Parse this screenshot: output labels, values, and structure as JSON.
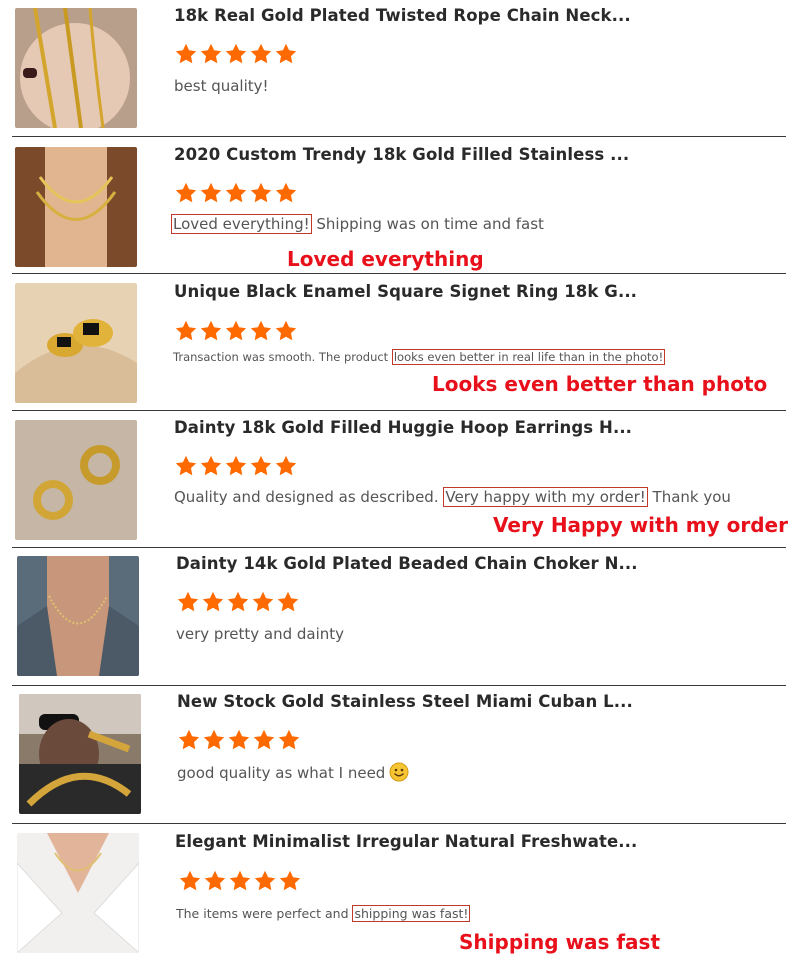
{
  "colors": {
    "star": "#ff6a00",
    "annotation": "#e8101a",
    "highlight_box": "#c0392b"
  },
  "reviews": [
    {
      "title": "18k Real Gold Plated Twisted Rope Chain Neck...",
      "rating": 5,
      "comment_before": "best quality!",
      "comment_highlight": "",
      "comment_after": "",
      "annotation": ""
    },
    {
      "title": "2020 Custom Trendy 18k Gold Filled Stainless ...",
      "rating": 5,
      "comment_before": "",
      "comment_highlight": "Loved everything!",
      "comment_after": " Shipping was on time and fast",
      "annotation": "Loved everything"
    },
    {
      "title": "Unique Black Enamel Square Signet Ring 18k G...",
      "rating": 5,
      "comment_before": "Transaction was smooth. The product ",
      "comment_highlight": "looks even better in real life than in the photo!",
      "comment_after": "",
      "annotation": "Looks even better than photo"
    },
    {
      "title": "Dainty 18k Gold Filled Huggie Hoop Earrings H...",
      "rating": 5,
      "comment_before": "Quality and designed as described. ",
      "comment_highlight": "Very happy with my order!",
      "comment_after": " Thank you",
      "annotation": "Very Happy with my order"
    },
    {
      "title": "Dainty 14k Gold Plated Beaded Chain Choker N...",
      "rating": 5,
      "comment_before": "very pretty and dainty",
      "comment_highlight": "",
      "comment_after": "",
      "annotation": ""
    },
    {
      "title": "New Stock Gold Stainless Steel Miami Cuban L...",
      "rating": 5,
      "comment_before": "good quality as what I need",
      "comment_highlight": "",
      "comment_after": "",
      "emoji": "smiling-face",
      "annotation": ""
    },
    {
      "title": "Elegant Minimalist Irregular Natural Freshwate...",
      "rating": 5,
      "comment_before": "The items were perfect and ",
      "comment_highlight": "shipping was fast!",
      "comment_after": "",
      "annotation": "Shipping was fast"
    }
  ]
}
